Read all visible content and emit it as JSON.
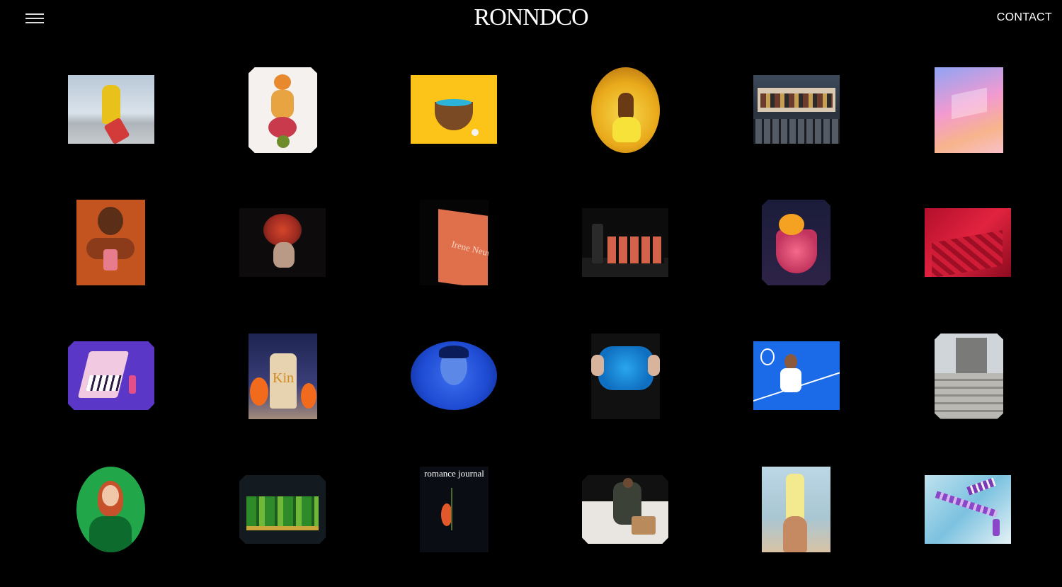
{
  "header": {
    "logo": "RONNDCO",
    "contact_label": "CONTACT"
  },
  "grid_text": {
    "book_title": "Irene Neuw",
    "journal_title": "romance journal",
    "kin_label": "Kin"
  },
  "colors": {
    "background": "#000000",
    "text": "#ffffff"
  }
}
